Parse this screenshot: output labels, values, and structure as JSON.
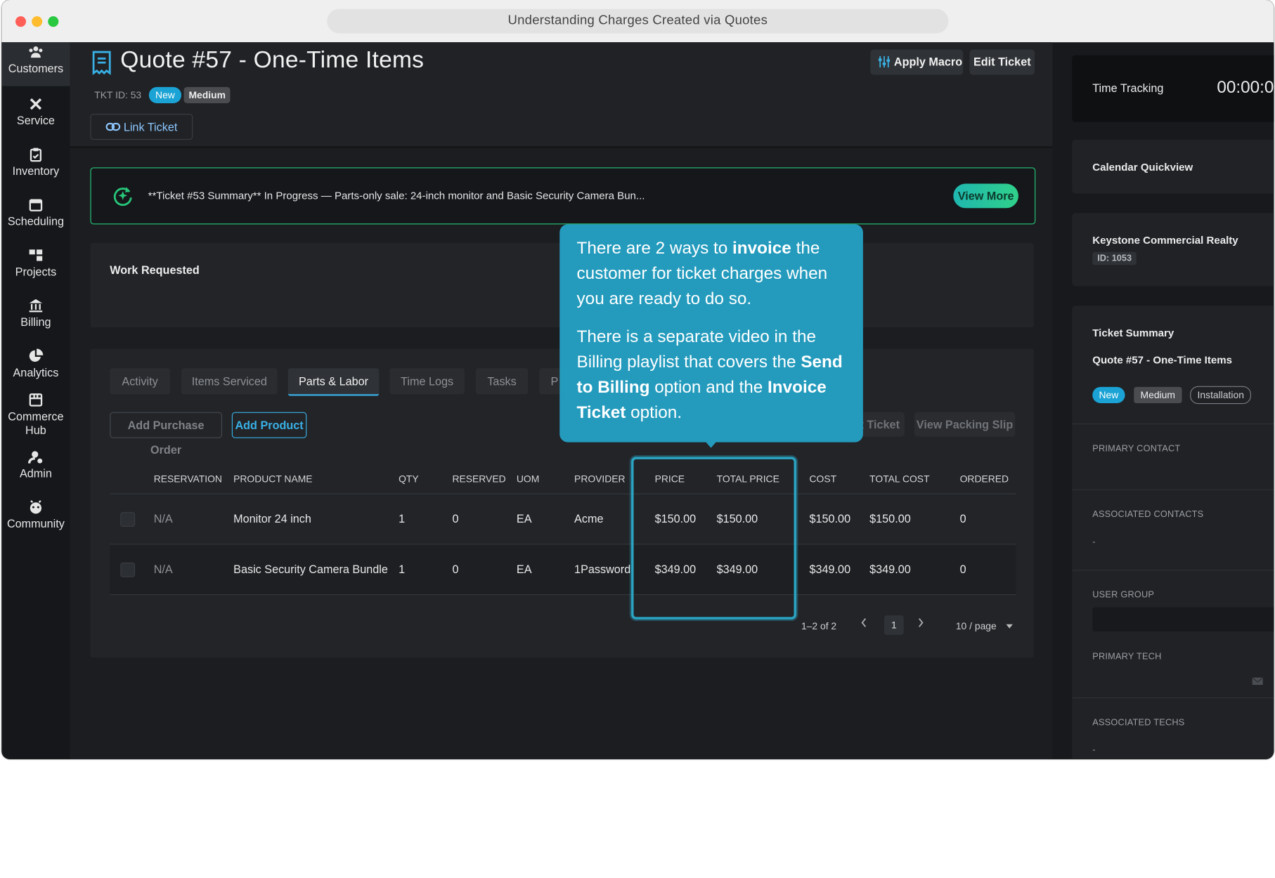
{
  "window": {
    "title": "Understanding Charges Created via Quotes"
  },
  "sidebar": {
    "items": [
      {
        "label": "Customers"
      },
      {
        "label": "Service"
      },
      {
        "label": "Inventory"
      },
      {
        "label": "Scheduling"
      },
      {
        "label": "Projects"
      },
      {
        "label": "Billing"
      },
      {
        "label": "Analytics"
      },
      {
        "label": "Commerce Hub"
      },
      {
        "label": "Admin"
      },
      {
        "label": "Community"
      }
    ],
    "help_label": "?"
  },
  "header": {
    "title": "Quote #57 - One-Time Items",
    "ticket_id": "TKT ID: 53",
    "status": "New",
    "priority": "Medium",
    "link_ticket": "Link Ticket",
    "apply_macro": "Apply Macro",
    "edit_ticket": "Edit Ticket"
  },
  "summary": {
    "text": "**Ticket #53 Summary** In Progress — Parts-only sale: 24-inch monitor and Basic Security Camera Bun...",
    "view_more": "View More"
  },
  "work_requested": {
    "label": "Work Requested"
  },
  "tabs": [
    "Activity",
    "Items Serviced",
    "Parts & Labor",
    "Time Logs",
    "Tasks",
    "P"
  ],
  "actions": {
    "add_purchase_order": "Add Purchase Order",
    "add_product": "Add Product",
    "ticket_partial": "t Ticket",
    "view_packing_slip": "View Packing Slip"
  },
  "table": {
    "headers": [
      "RESERVATION",
      "PRODUCT NAME",
      "QTY",
      "RESERVED",
      "UOM",
      "PROVIDER",
      "PRICE",
      "TOTAL PRICE",
      "COST",
      "TOTAL COST",
      "ORDERED"
    ],
    "rows": [
      [
        "N/A",
        "Monitor 24 inch",
        "1",
        "0",
        "EA",
        "Acme",
        "$150.00",
        "$150.00",
        "$150.00",
        "$150.00",
        "0"
      ],
      [
        "N/A",
        "Basic Security Camera Bundle",
        "1",
        "0",
        "EA",
        "1Password",
        "$349.00",
        "$349.00",
        "$349.00",
        "$349.00",
        "0"
      ]
    ],
    "pagination": {
      "range": "1–2 of 2",
      "page": "1",
      "page_size": "10 / page"
    }
  },
  "tooltip": {
    "p1_a": "There are 2 ways to ",
    "p1_b": "invoice",
    "p1_c": " the customer for ticket charges when you are ready to do so.",
    "p2_a": "There is a separate video in the Billing playlist that covers the ",
    "p2_b": "Send to Billing",
    "p2_c": " option and the ",
    "p2_d": "Invoice Ticket",
    "p2_e": " option."
  },
  "right_panel": {
    "time_tracking_label": "Time Tracking",
    "time_tracking_value": "00:00:0",
    "calendar_quickview": "Calendar Quickview",
    "customer_name": "Keystone Commercial Realty",
    "customer_id": "ID: 1053",
    "ticket_summary_label": "Ticket Summary",
    "ticket_summary_title": "Quote #57 - One-Time Items",
    "tags": [
      "New",
      "Medium",
      "Installation"
    ],
    "primary_contact": "PRIMARY CONTACT",
    "associated_contacts": "ASSOCIATED CONTACTS",
    "associated_contacts_value": "-",
    "user_group": "USER GROUP",
    "primary_tech": "PRIMARY TECH",
    "associated_techs": "ASSOCIATED TECHS",
    "associated_techs_value": "-"
  },
  "colors": {
    "accent": "#1aa3d4",
    "tooltip": "#249bbd",
    "summary_border": "#27c77a",
    "background": "#1b1d20"
  }
}
